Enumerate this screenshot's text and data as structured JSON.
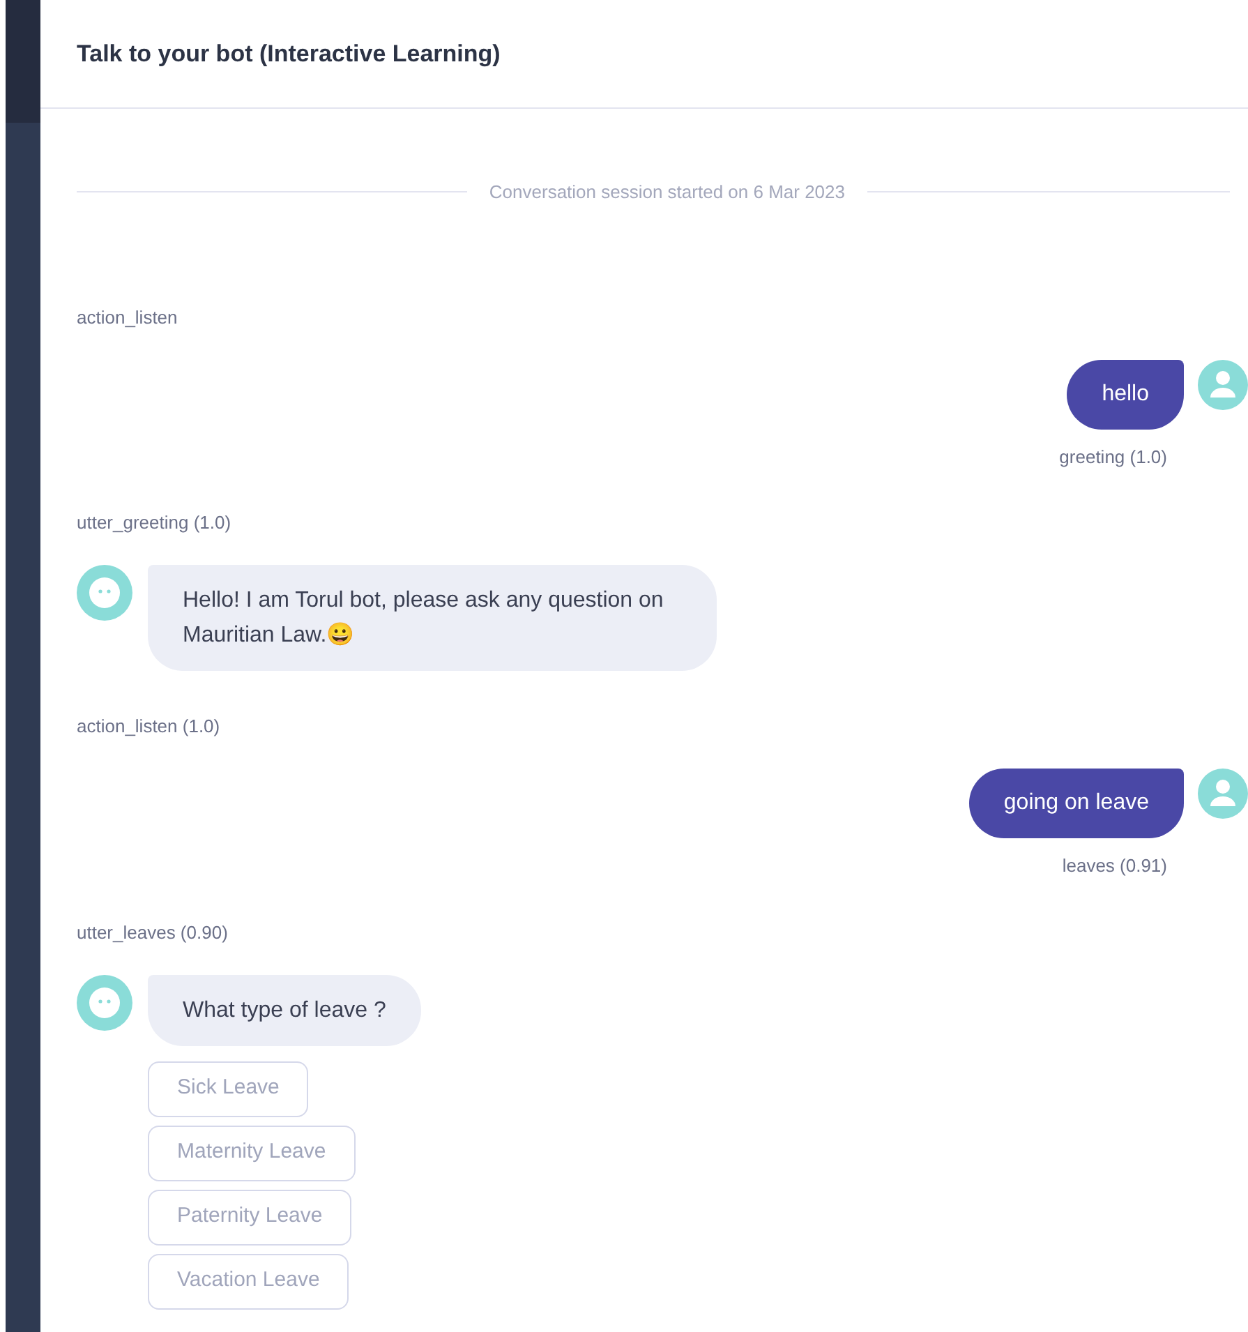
{
  "header": {
    "title": "Talk to your bot (Interactive Learning)"
  },
  "session_divider": "Conversation session started on 6 Mar 2023",
  "events": [
    {
      "kind": "action",
      "label": "action_listen"
    },
    {
      "kind": "user",
      "text": "hello",
      "intent": "greeting (1.0)"
    },
    {
      "kind": "action",
      "label": "utter_greeting (1.0)"
    },
    {
      "kind": "bot",
      "text": "Hello! I am Torul bot, please ask any question on Mauritian Law.😀"
    },
    {
      "kind": "action",
      "label": "action_listen (1.0)"
    },
    {
      "kind": "user",
      "text": "going on leave",
      "intent": "leaves (0.91)"
    },
    {
      "kind": "action",
      "label": "utter_leaves (0.90)"
    },
    {
      "kind": "bot",
      "text": "What type of leave ?",
      "buttons": [
        "Sick Leave",
        "Maternity Leave",
        "Paternity Leave",
        "Vacation Leave"
      ]
    }
  ]
}
